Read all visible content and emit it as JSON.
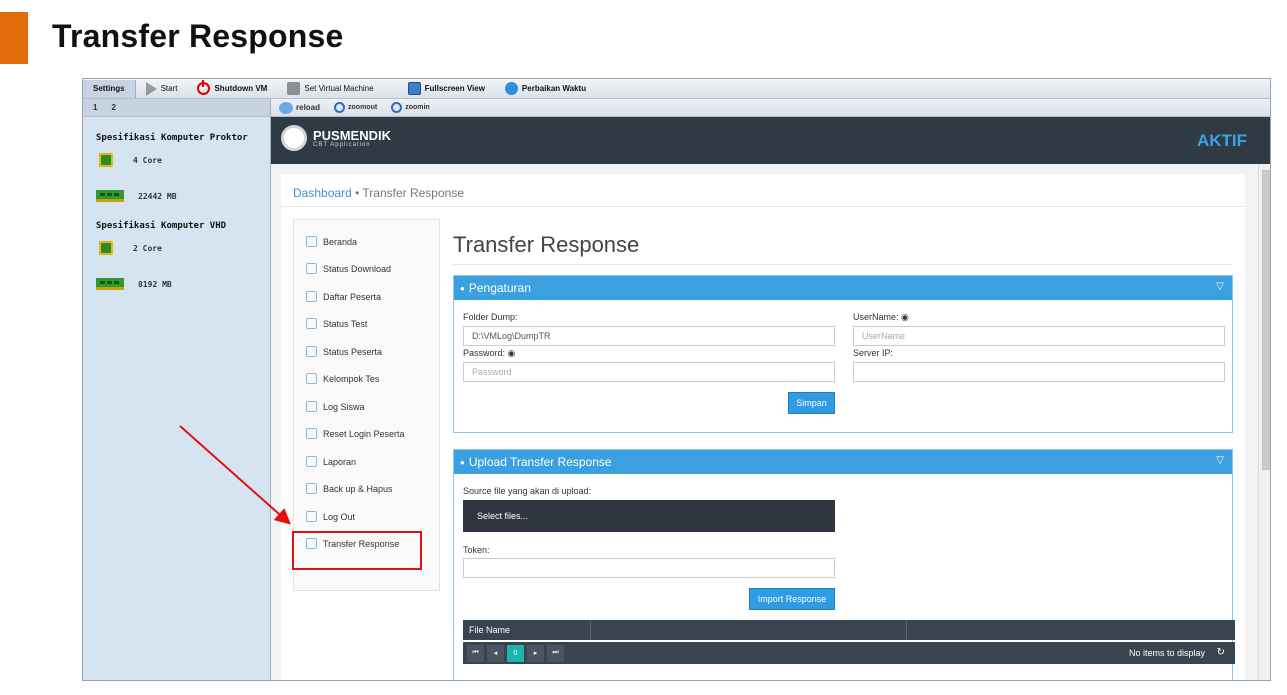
{
  "slide": {
    "title": "Transfer Response",
    "accent_color": "#e26b0a"
  },
  "vm_toolbar": {
    "settings_tab": "Settings",
    "start": "Start",
    "shutdown": "Shutdown VM",
    "set_vm": "Set Virtual Machine",
    "fullscreen": "Fullscreen View",
    "fix_time": "Perbaikan Waktu",
    "pages": [
      "1",
      "2"
    ],
    "reload": "reload",
    "zoomout": "zoomout",
    "zoomin": "zoomin"
  },
  "specs": {
    "proktor_title": "Spesifikasi Komputer Proktor",
    "proktor_cpu": "4 Core",
    "proktor_ram": "22442 MB",
    "vhd_title": "Spesifikasi Komputer VHD",
    "vhd_cpu": "2 Core",
    "vhd_ram": "8192 MB"
  },
  "app": {
    "brand_name": "PUSMENDIK",
    "brand_sub": "CBT Application",
    "status": "AKTIF",
    "breadcrumb_home": "Dashboard",
    "breadcrumb_sep": "•",
    "breadcrumb_current": "Transfer Response",
    "nav": [
      {
        "label": "Beranda",
        "icon": "home-icon"
      },
      {
        "label": "Status Download",
        "icon": "cloud-download-icon"
      },
      {
        "label": "Daftar Peserta",
        "icon": "document-icon"
      },
      {
        "label": "Status Test",
        "icon": "edit-icon"
      },
      {
        "label": "Status Peserta",
        "icon": "user-icon"
      },
      {
        "label": "Kelompok Tes",
        "icon": "group-icon"
      },
      {
        "label": "Log Siswa",
        "icon": "document-icon"
      },
      {
        "label": "Reset Login Peserta",
        "icon": "refresh-icon"
      },
      {
        "label": "Laporan",
        "icon": "printer-icon"
      },
      {
        "label": "Back up & Hapus",
        "icon": "gear-icon"
      },
      {
        "label": "Log Out",
        "icon": "logout-icon"
      },
      {
        "label": "Transfer Response",
        "icon": "rss-icon"
      }
    ],
    "page_title": "Transfer Response",
    "settings_panel": {
      "title": "Pengaturan",
      "folder_label": "Folder Dump:",
      "folder_value": "D:\\VMLog\\DumpTR",
      "password_label": "Password:",
      "password_placeholder": "Password",
      "username_label": "UserName:",
      "username_placeholder": "UserName",
      "server_label": "Server IP:",
      "save_label": "Simpan"
    },
    "upload_panel": {
      "title": "Upload Transfer Response",
      "source_label": "Source file yang akan di upload:",
      "select_label": "Select files...",
      "token_label": "Token:",
      "import_label": "Import Response",
      "grid_col_file": "File Name",
      "pager_page": "0",
      "no_items": "No items to display"
    }
  }
}
